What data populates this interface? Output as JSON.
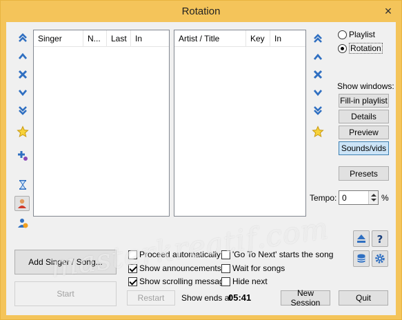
{
  "window": {
    "title": "Rotation",
    "close": "✕"
  },
  "singers_list": {
    "columns": [
      "Singer",
      "N...",
      "Last",
      "In"
    ]
  },
  "songs_list": {
    "columns": [
      "Artist / Title",
      "Key",
      "In"
    ]
  },
  "view_mode": {
    "options": [
      "Playlist",
      "Rotation"
    ],
    "selected": "Rotation"
  },
  "show_windows": {
    "label": "Show windows:",
    "buttons": [
      "Fill-in playlist",
      "Details",
      "Preview",
      "Sounds/vids"
    ],
    "active": "Sounds/vids"
  },
  "presets_label": "Presets",
  "tempo": {
    "label": "Tempo:",
    "value": "0",
    "unit": "%"
  },
  "add_singer_label": "Add Singer / Song...",
  "start_label": "Start",
  "restart_label": "Restart",
  "options": {
    "proceed_automatically": {
      "label": "Proceed automatically",
      "checked": false
    },
    "show_announcements": {
      "label": "Show announcements",
      "checked": true
    },
    "show_scrolling_message": {
      "label": "Show scrolling message",
      "checked": true
    },
    "go_to_next": {
      "label": "'Go To Next' starts the song",
      "checked": false
    },
    "wait_for_songs": {
      "label": "Wait for songs",
      "checked": false
    },
    "hide_next": {
      "label": "Hide next",
      "checked": false
    }
  },
  "show_ends": {
    "label": "Show ends at",
    "time": "05:41"
  },
  "new_session_label": "New Session",
  "quit_label": "Quit",
  "watermark": "masterkreatif.com",
  "colors": {
    "title_bar": "#f4c45a",
    "icon_blue": "#2f6fc1",
    "accent_active": "#cce4f7"
  }
}
